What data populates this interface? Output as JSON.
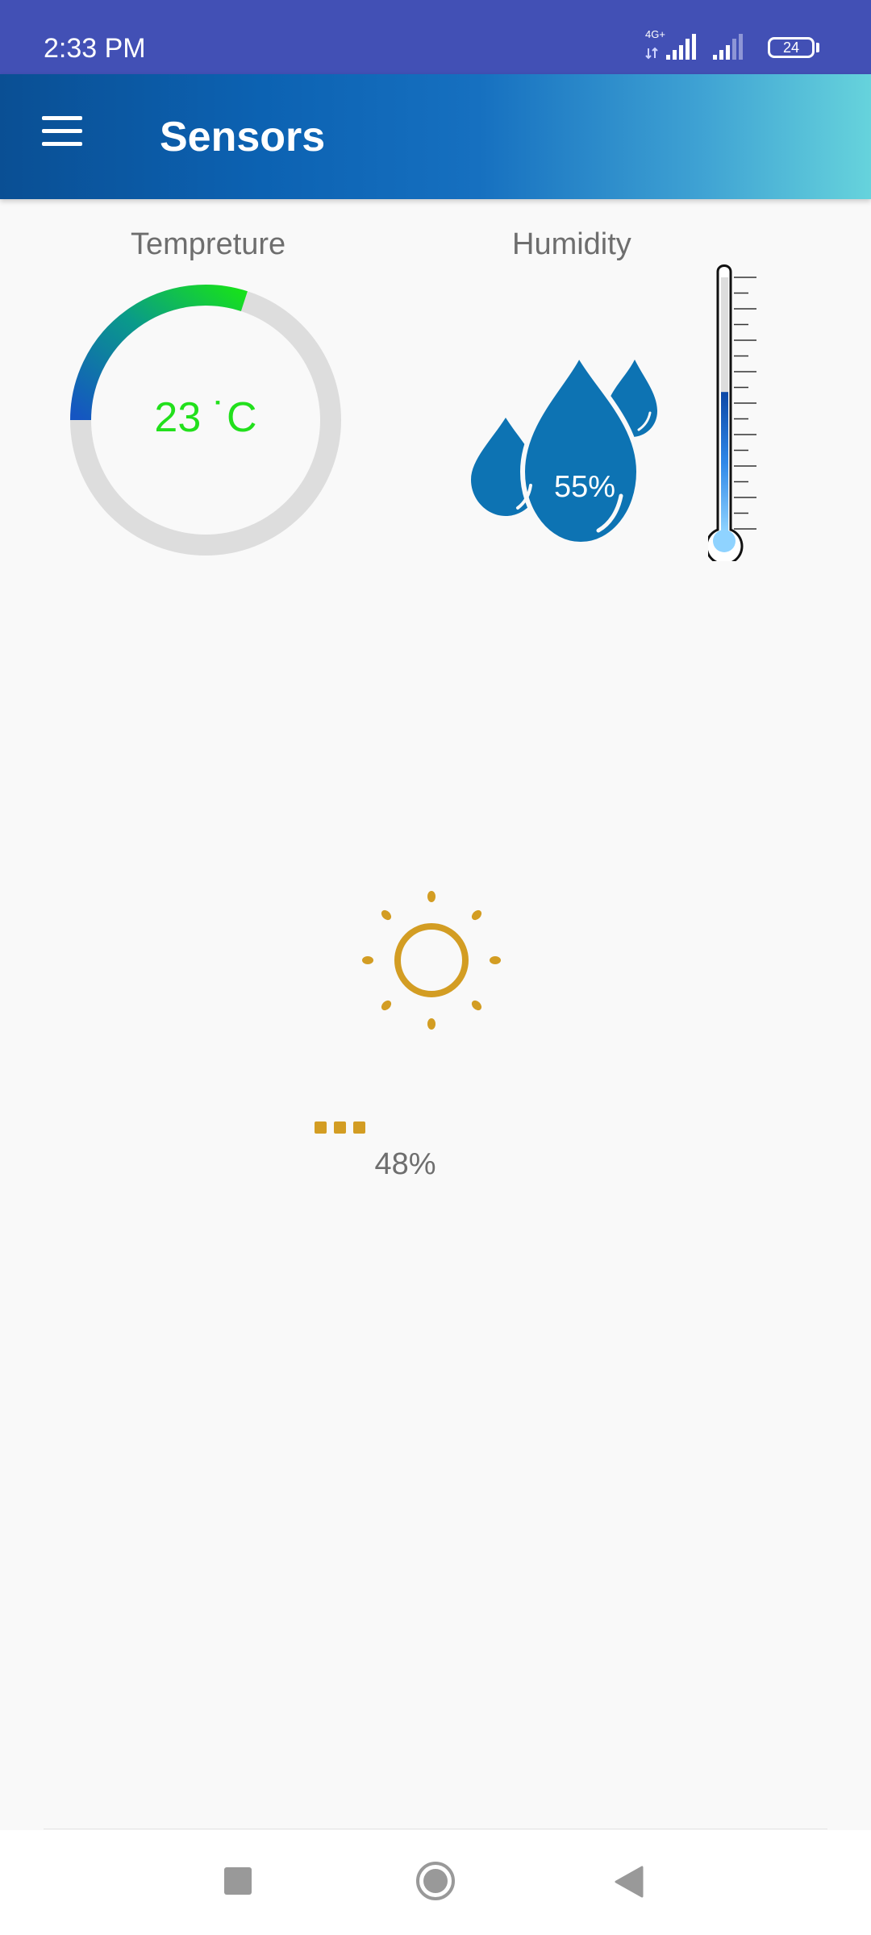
{
  "status_bar": {
    "time": "2:33 PM",
    "network": "4G+",
    "battery": "24",
    "icons": [
      "signal-4g-icon",
      "signal-icon",
      "battery-icon"
    ]
  },
  "app_bar": {
    "title": "Sensors",
    "menu_icon": "menu-icon"
  },
  "temperature": {
    "label": "Tempreture",
    "value": "23 ˙C",
    "gauge_fraction": 0.3,
    "colors": {
      "track": "#dddddd",
      "start": "#1555c2",
      "end": "#17e01d",
      "text": "#22e01c"
    }
  },
  "humidity": {
    "label": "Humidity",
    "value": "55%",
    "drop_color": "#0d73b3",
    "thermometer_level": 0.55
  },
  "light": {
    "icon": "sun-icon",
    "value": "48%",
    "loading_icon": "loading-dots-icon",
    "color": "#d39d23"
  },
  "nav_bar": {
    "icons": [
      "recent-apps-icon",
      "home-icon",
      "back-icon"
    ]
  }
}
